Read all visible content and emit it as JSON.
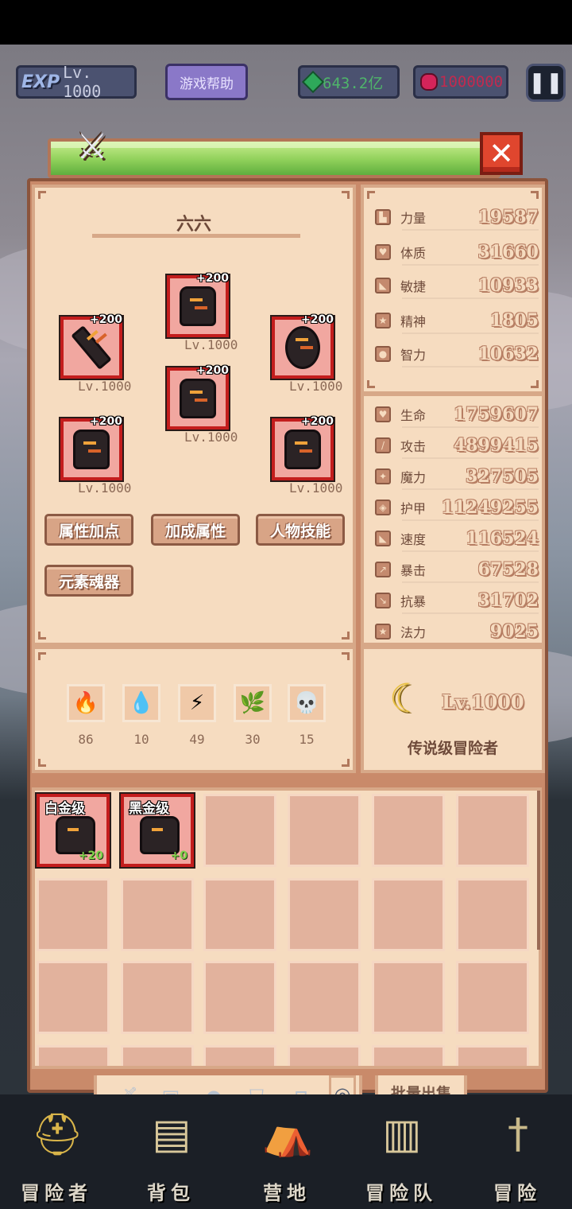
{
  "topbar": {
    "exp_logo": "EXP",
    "level": "Lv. 1000",
    "help_button": "游戏帮助",
    "gems": "643.2亿",
    "rubies": "1000000",
    "pause_icon": "pause-icon"
  },
  "character": {
    "name": "六六",
    "equipment": [
      {
        "slot": "helmet",
        "plus": "+200",
        "level": "Lv.1000"
      },
      {
        "slot": "weapon",
        "plus": "+200",
        "level": "Lv.1000"
      },
      {
        "slot": "shield",
        "plus": "+200",
        "level": "Lv.1000"
      },
      {
        "slot": "armor",
        "plus": "+200",
        "level": "Lv.1000"
      },
      {
        "slot": "gloves",
        "plus": "+200",
        "level": "Lv.1000"
      },
      {
        "slot": "accessory",
        "plus": "+200",
        "level": "Lv.1000"
      }
    ],
    "buttons": [
      "属性加点",
      "加成属性",
      "人物技能",
      "元素魂器"
    ]
  },
  "elements": [
    {
      "name": "fire",
      "icon": "fire-icon",
      "glyph": "🔥",
      "count": "86"
    },
    {
      "name": "water",
      "icon": "water-drop-icon",
      "glyph": "💧",
      "count": "10"
    },
    {
      "name": "lightning",
      "icon": "lightning-icon",
      "glyph": "⚡",
      "count": "49"
    },
    {
      "name": "nature",
      "icon": "leaf-icon",
      "glyph": "🌿",
      "count": "30"
    },
    {
      "name": "death",
      "icon": "skull-icon",
      "glyph": "💀",
      "count": "15"
    }
  ],
  "base_stats": [
    {
      "label": "力量",
      "value": "19587",
      "icon": "strength-icon"
    },
    {
      "label": "体质",
      "value": "31660",
      "icon": "heart-icon"
    },
    {
      "label": "敏捷",
      "value": "10933",
      "icon": "boot-icon"
    },
    {
      "label": "精神",
      "value": "1805",
      "icon": "star-icon"
    },
    {
      "label": "智力",
      "value": "10632",
      "icon": "brain-icon"
    }
  ],
  "combat_stats": [
    {
      "label": "生命",
      "value": "1759607",
      "icon": "heart-icon"
    },
    {
      "label": "攻击",
      "value": "4899415",
      "icon": "sword-icon"
    },
    {
      "label": "魔力",
      "value": "327505",
      "icon": "wand-icon"
    },
    {
      "label": "护甲",
      "value": "11249255",
      "icon": "shield-icon"
    },
    {
      "label": "速度",
      "value": "116524",
      "icon": "boot-icon"
    },
    {
      "label": "暴击",
      "value": "67528",
      "icon": "crit-icon"
    },
    {
      "label": "抗暴",
      "value": "31702",
      "icon": "crit-resist-icon"
    },
    {
      "label": "法力",
      "value": "9025",
      "icon": "star-icon"
    }
  ],
  "title_badge": {
    "level": "Lv.1000",
    "rank": "传说级冒险者"
  },
  "inventory": {
    "items": [
      {
        "grade": "白金级",
        "enhance": "+20"
      },
      {
        "grade": "黑金级",
        "enhance": "+0"
      }
    ]
  },
  "filter_tabs": [
    "weapon-tab-icon",
    "shield-tab-icon",
    "helmet-tab-icon",
    "armor-tab-icon",
    "gloves-tab-icon",
    "ring-tab-icon"
  ],
  "bulk_sell": "批量出售",
  "bottom_nav": [
    {
      "label": "冒险者",
      "icon": "helmet-icon"
    },
    {
      "label": "背包",
      "icon": "backpack-icon"
    },
    {
      "label": "营地",
      "icon": "camp-icon"
    },
    {
      "label": "冒险队",
      "icon": "book-icon"
    },
    {
      "label": "冒险",
      "icon": "sword-icon"
    }
  ],
  "colors": {
    "panel_bg": "#f6dcc0",
    "frame": "#c98a6a",
    "item_border": "#c31d1d",
    "header_green": "#8fd05a",
    "close_red": "#e0462e"
  }
}
